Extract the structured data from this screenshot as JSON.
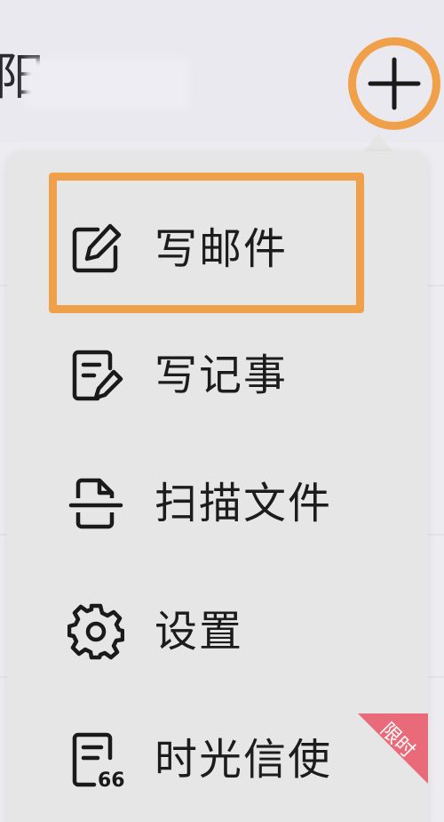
{
  "header": {
    "partial_glyph": "阳",
    "add_button_symbol": "+"
  },
  "menu": {
    "items": [
      {
        "label": "写邮件",
        "icon": "compose-icon"
      },
      {
        "label": "写记事",
        "icon": "note-edit-icon"
      },
      {
        "label": "扫描文件",
        "icon": "scan-document-icon"
      },
      {
        "label": "设置",
        "icon": "gear-icon"
      },
      {
        "label": "时光信使",
        "icon": "time-letter-icon"
      }
    ],
    "badge": "限时"
  },
  "colors": {
    "highlight": "#f0a049",
    "badge": "#e96a78",
    "menu_background": "#e6e6e6",
    "text": "#1c1c1c"
  }
}
